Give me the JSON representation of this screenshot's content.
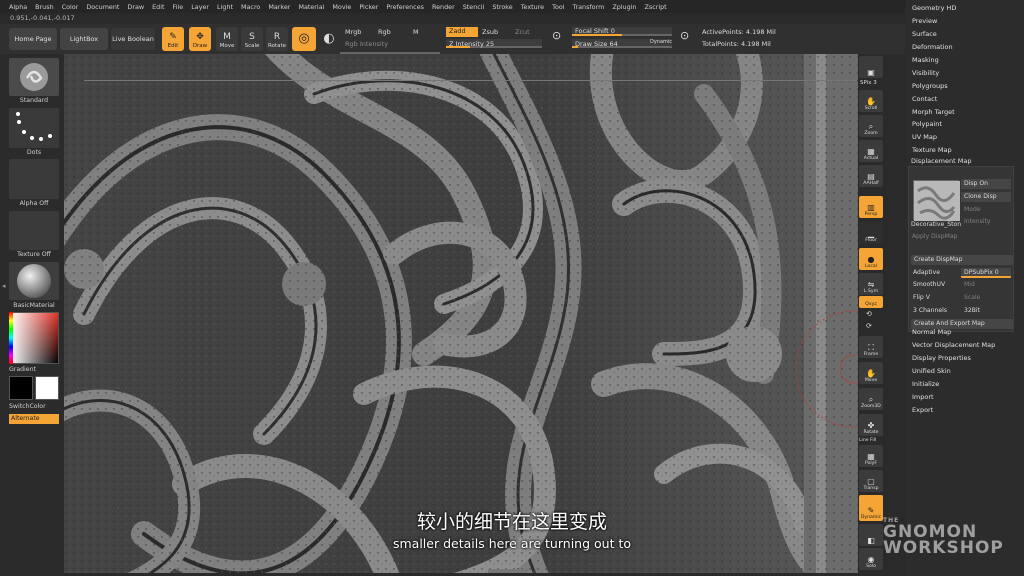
{
  "menu": [
    "Alpha",
    "Brush",
    "Color",
    "Document",
    "Draw",
    "Edit",
    "File",
    "Layer",
    "Light",
    "Macro",
    "Marker",
    "Material",
    "Movie",
    "Picker",
    "Preferences",
    "Render",
    "Stencil",
    "Stroke",
    "Texture",
    "Tool",
    "Transform",
    "Zplugin",
    "Zscript"
  ],
  "coords": "0.951,-0.041,-0.017",
  "top": {
    "home_page": "Home Page",
    "lightbox": "LightBox",
    "live_boolean": "Live Boolean",
    "edit": "Edit",
    "draw": "Draw",
    "move": "Move",
    "scale": "Scale",
    "rotate": "Rotate",
    "mrgb": "Mrgb",
    "rgb": "Rgb",
    "m": "M",
    "rgb_intensity": "Rgb Intensity",
    "zadd": "Zadd",
    "zsub": "Zsub",
    "zcut": "Zcut",
    "z_intensity": "Z Intensity 25",
    "focal_shift": "Focal Shift 0",
    "draw_size": "Draw Size 64",
    "dynamic": "Dynamic",
    "active_points": "ActivePoints: 4.198 Mil",
    "total_points": "TotalPoints: 4.198 Mil"
  },
  "left": {
    "standard": "Standard",
    "dots": "Dots",
    "alpha_off": "Alpha Off",
    "texture_off": "Texture Off",
    "basic_material": "BasicMaterial",
    "gradient": "Gradient",
    "switch_color": "SwitchColor",
    "alternate": "Alternate"
  },
  "shelf": {
    "spix": "SPix 3",
    "scroll": "Scroll",
    "zoom": "Zoom",
    "actual": "Actual",
    "aahalf": "AAHalf",
    "persp": "Persp",
    "floor": "Floor",
    "local": "Local",
    "lsym": "L.Sym",
    "xyz": "Qxyz",
    "frame": "Frame",
    "move": "Move",
    "zoom3d": "Zoom3D",
    "rotate": "Rotate",
    "line_fill": "Line Fill",
    "polyf": "PolyF",
    "transp": "Transp",
    "dynamic": "Dynamic",
    "solo": "Solo"
  },
  "right": {
    "items_top": [
      "Geometry HD",
      "Preview",
      "Surface",
      "Deformation",
      "Masking",
      "Visibility",
      "Polygroups",
      "Contact",
      "Morph Target",
      "Polypaint",
      "UV Map",
      "Texture Map",
      "Displacement Map"
    ],
    "disp_on": "Disp On",
    "clone_disp": "Clone Disp",
    "mode": "Mode",
    "intensity": "Intensity",
    "texture_name": "Decorative_Ston",
    "apply_dispmap": "Apply DispMap",
    "create_dispmap": "Create DispMap",
    "adaptive": "Adaptive",
    "dpsubpix": "DPSubPix 0",
    "smoothuv": "SmoothUV",
    "mid": "Mid",
    "flipv": "Flip V",
    "scale": "Scale",
    "channels": "3 Channels",
    "bit": "32Bit",
    "create_export": "Create And Export Map",
    "items_bottom": [
      "Normal Map",
      "Vector Displacement Map",
      "Display Properties",
      "Unified Skin",
      "Initialize",
      "Import",
      "Export"
    ]
  },
  "subtitle_zh": "较小的细节在这里变成",
  "subtitle_en": "smaller details here are turning out to",
  "watermark": {
    "the": "THE",
    "line1": "GNOMON",
    "line2": "WORKSHOP"
  },
  "colors": {
    "accent": "#f4a536",
    "panel": "#2c2c2c",
    "viewport": "#3a3a3a"
  }
}
